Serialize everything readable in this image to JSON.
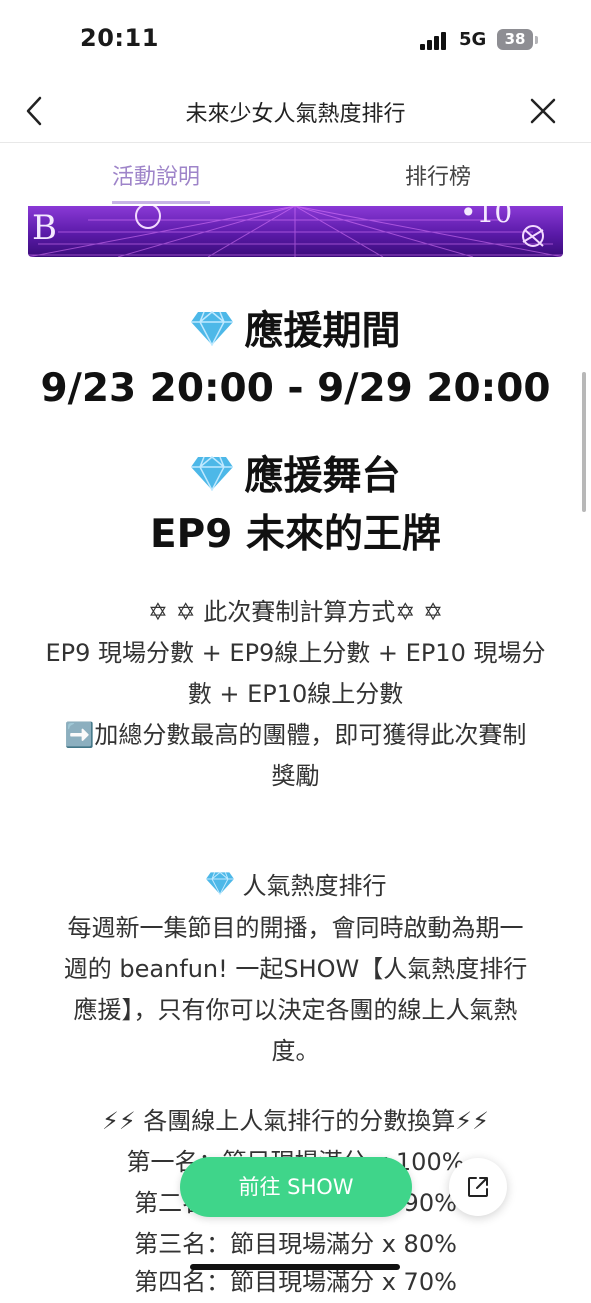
{
  "status_bar": {
    "time": "20:11",
    "network": "5G",
    "battery": "38"
  },
  "nav": {
    "title": "未來少女人氣熱度排行"
  },
  "tabs": {
    "active": "活動說明",
    "inactive": "排行榜"
  },
  "support_period": {
    "heading": "應援期間",
    "dates": "9/23 20:00 - 9/29 20:00"
  },
  "support_stage": {
    "heading": "應援舞台",
    "episode": "EP9 未來的王牌"
  },
  "scoring": {
    "title": "✡ ✡ 此次賽制計算方式✡ ✡",
    "line1": "EP9 現場分數 + EP9線上分數 + EP10 現場分",
    "line2": "數 + EP10線上分數",
    "line3": "➡️加總分數最高的團體，即可獲得此次賽制",
    "line4": "獎勵"
  },
  "ranking_intro": {
    "title": "人氣熱度排行",
    "line1": "每週新一集節目的開播，會同時啟動為期一",
    "line2": "週的 beanfun! 一起SHOW【人氣熱度排行",
    "line3": "應援】，只有你可以決定各團的線上人氣熱",
    "line4": "度。"
  },
  "conversion": {
    "title": "⚡⚡ 各團線上人氣排行的分數換算⚡⚡",
    "rank1": "第一名：節目現場滿分 x 100%",
    "rank2": "第二名：節目現場滿分 x 90%",
    "rank3": "第三名：節目現場滿分 x 80%",
    "rank4": "第四名：節目現場滿分 x 70%"
  },
  "buttons": {
    "go_show": "前往 SHOW"
  },
  "icons": {
    "back": "chevron-left-icon",
    "close": "close-icon",
    "gem": "diamond-gem-icon",
    "share": "external-link-icon"
  },
  "colors": {
    "accent": "#9e84c9",
    "cta": "#3fd58a",
    "gem": "#4db8e8"
  }
}
